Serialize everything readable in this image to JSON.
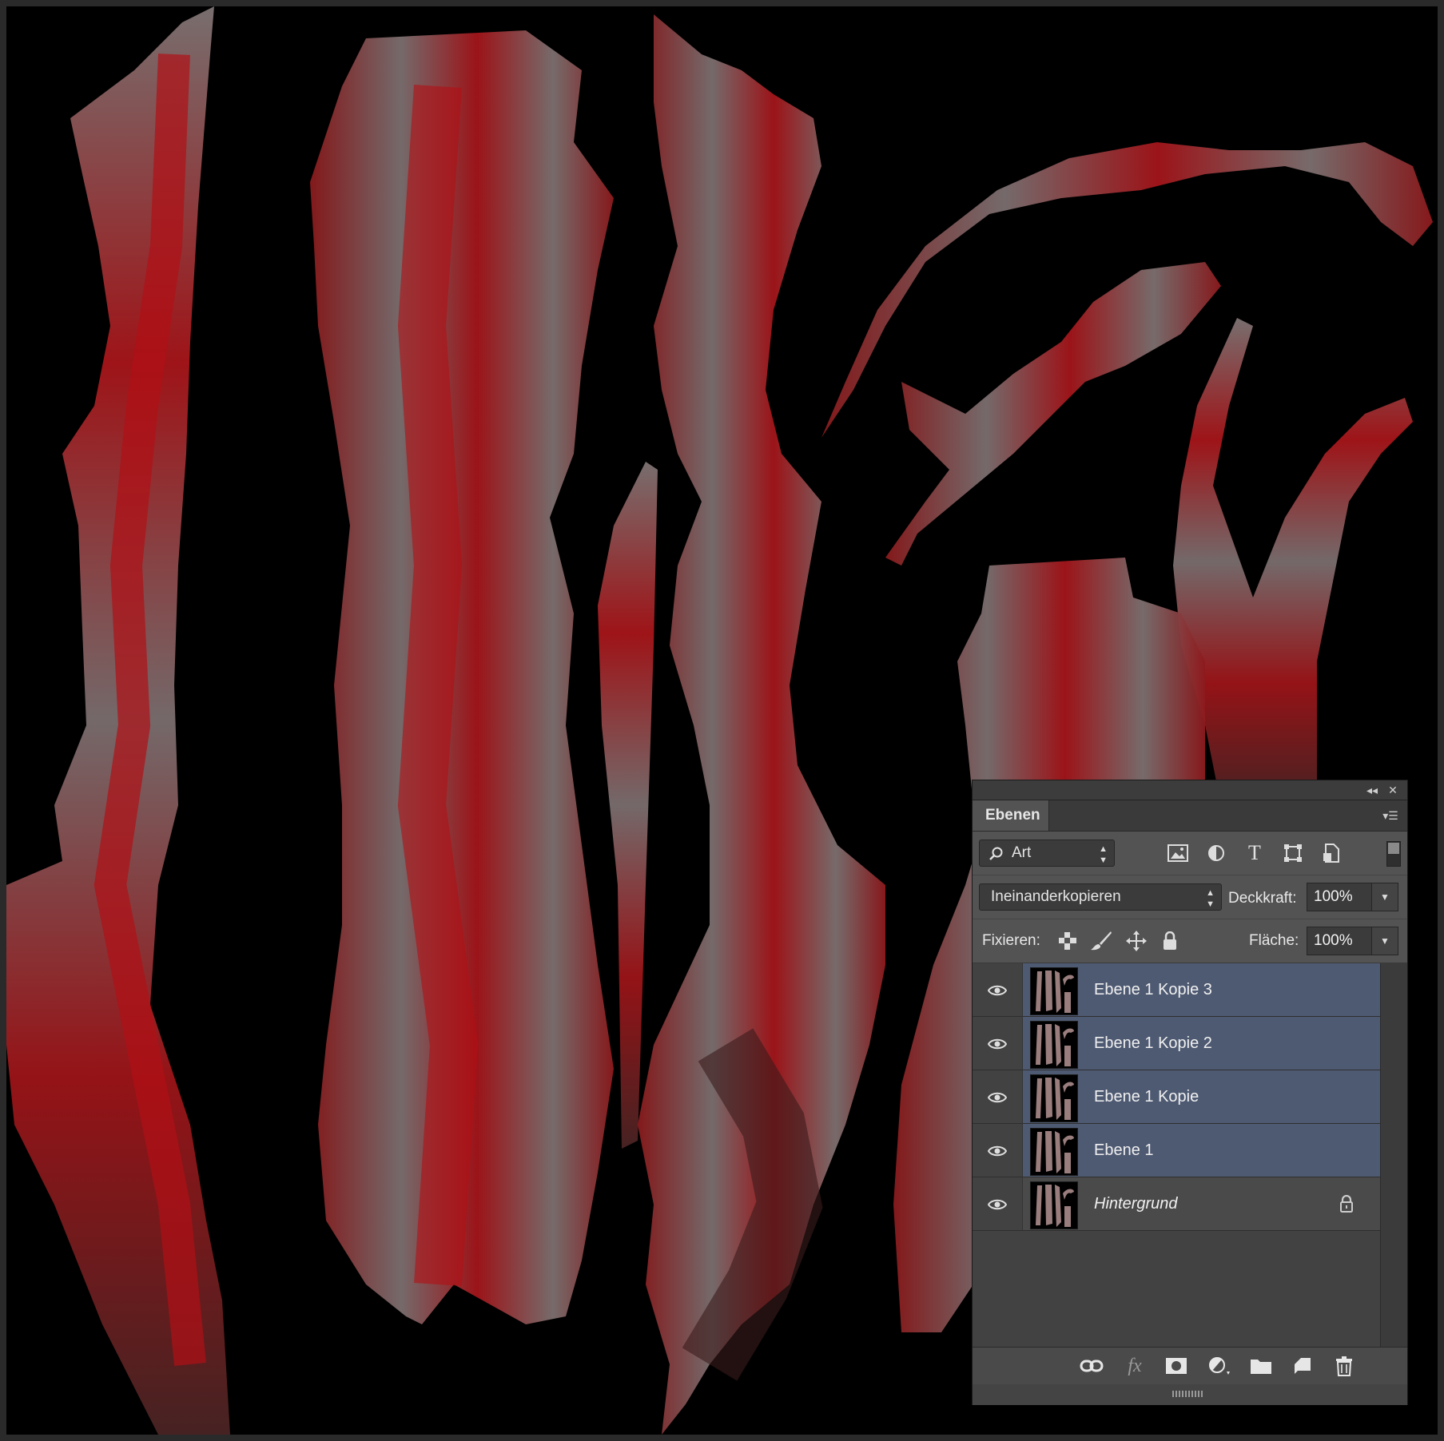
{
  "panel": {
    "tab_label": "Ebenen",
    "filter": {
      "value": "Art"
    },
    "filter_icons": [
      "image-filter-icon",
      "adjustment-filter-icon",
      "type-filter-icon",
      "shape-filter-icon",
      "smart-object-filter-icon"
    ],
    "blend_mode": "Ineinanderkopieren",
    "opacity_label": "Deckkraft:",
    "opacity_value": "100%",
    "lock_label": "Fixieren:",
    "lock_icons": [
      "lock-transparent-icon",
      "lock-image-icon",
      "lock-position-icon",
      "lock-all-icon"
    ],
    "fill_label": "Fläche:",
    "fill_value": "100%",
    "layers": [
      {
        "name": "Ebene 1 Kopie 3",
        "visible": true,
        "selected": true,
        "locked": false
      },
      {
        "name": "Ebene 1 Kopie 2",
        "visible": true,
        "selected": true,
        "locked": false
      },
      {
        "name": "Ebene 1 Kopie",
        "visible": true,
        "selected": true,
        "locked": false
      },
      {
        "name": "Ebene 1",
        "visible": true,
        "selected": true,
        "locked": false
      },
      {
        "name": "Hintergrund",
        "visible": true,
        "selected": false,
        "locked": true
      }
    ],
    "bottom_icons": [
      "link-icon",
      "fx-icon",
      "mask-icon",
      "adjustment-icon",
      "folder-icon",
      "new-layer-icon",
      "trash-icon"
    ],
    "fx_label": "fx"
  },
  "colors": {
    "selected_layer": "#4e5a72",
    "panel_bg": "#535353",
    "canvas_bg": "#000000",
    "texture_red": "#a80d12",
    "texture_gray": "#7a7a7a"
  }
}
